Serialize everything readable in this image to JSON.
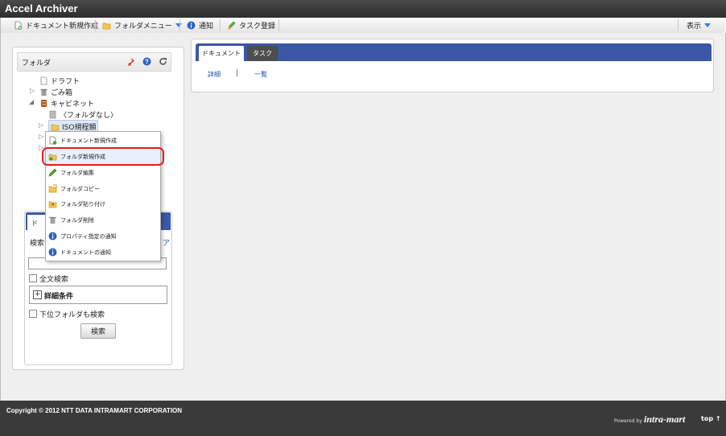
{
  "app": {
    "title": "Accel Archiver"
  },
  "toolbar": {
    "new_document": "ドキュメント新規作成",
    "folder_menu": "フォルダメニュー",
    "notify": "通知",
    "task_register": "タスク登録",
    "view": "表示"
  },
  "folder_panel": {
    "title": "フォルダ",
    "tree": {
      "draft": "ドラフト",
      "trash": "ごみ箱",
      "cabinet": "キャビネット",
      "no_folder": "〈フォルダなし〉",
      "iso": "ISO規程類"
    }
  },
  "context_menu": {
    "items": [
      "ドキュメント新規作成",
      "フォルダ新規作成",
      "フォルダ編集",
      "フォルダコピー",
      "フォルダ貼り付け",
      "フォルダ削除",
      "プロパティ指定の通知",
      "ドキュメントの通知"
    ]
  },
  "search_panel": {
    "tab_fragment": "ド",
    "label_fragment": "検索",
    "link_fragment": "ア",
    "fulltext": "全文検索",
    "detail": "詳細条件",
    "subfolder": "下位フォルダも検索",
    "button": "検索"
  },
  "main": {
    "tabs": [
      "ドキュメント",
      "タスク"
    ],
    "links": {
      "detail": "詳細",
      "separator": "|",
      "list": "一覧"
    }
  },
  "footer": {
    "copyright": "Copyright © 2012 NTT DATA INTRAMART CORPORATION",
    "powered_by": "Powered by",
    "logo": "intra-mart",
    "top": "top ↑"
  },
  "colors": {
    "accent": "#3b57a6",
    "highlight_ring": "#e0201b",
    "link": "#1c54a8"
  }
}
